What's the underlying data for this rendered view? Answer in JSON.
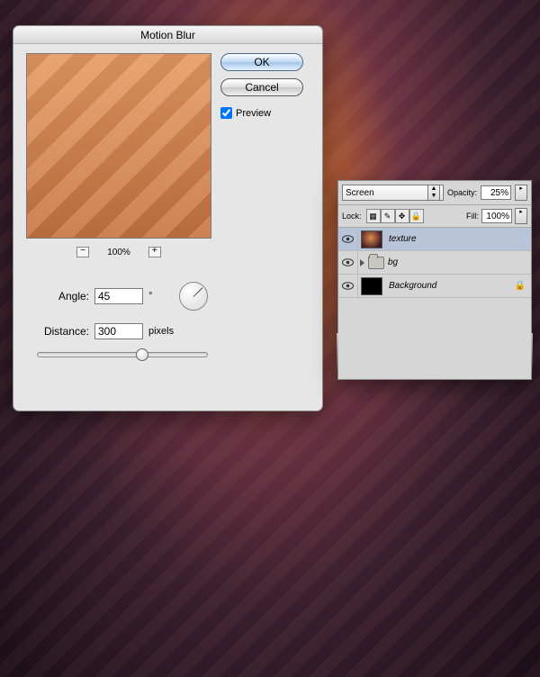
{
  "dialog": {
    "title": "Motion Blur",
    "ok": "OK",
    "cancel": "Cancel",
    "preview_label": "Preview",
    "preview_checked": true,
    "zoom_percent": "100%",
    "zoom_out": "−",
    "zoom_in": "+",
    "angle_label": "Angle:",
    "angle_value": "45",
    "angle_unit": "°",
    "distance_label": "Distance:",
    "distance_value": "300",
    "distance_unit": "pixels"
  },
  "layers_panel": {
    "blend_mode": "Screen",
    "opacity_label": "Opacity:",
    "opacity_value": "25%",
    "lock_label": "Lock:",
    "fill_label": "Fill:",
    "fill_value": "100%",
    "layers": [
      {
        "name": "texture",
        "visible": true,
        "selected": true,
        "kind": "texture"
      },
      {
        "name": "bg",
        "visible": true,
        "selected": false,
        "kind": "group"
      },
      {
        "name": "Background",
        "visible": true,
        "selected": false,
        "kind": "bg",
        "locked": true
      }
    ]
  }
}
